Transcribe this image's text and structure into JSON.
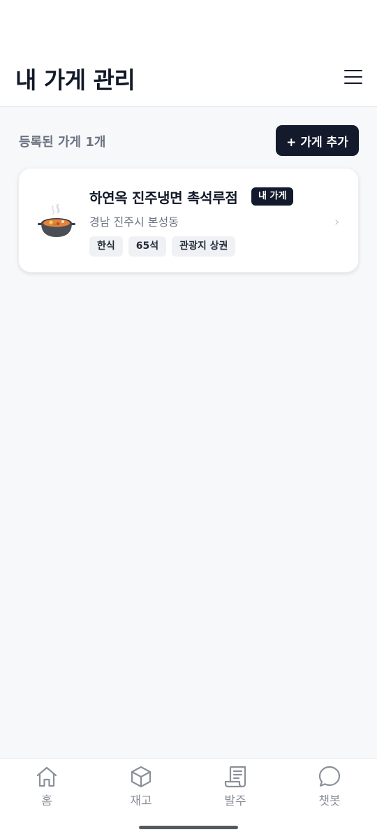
{
  "header": {
    "title": "내 가게 관리",
    "menu_icon": "hamburger-menu-icon"
  },
  "summary": {
    "count_label": "등록된 가게 1개",
    "add_button": "+ 가게 추가"
  },
  "stores": [
    {
      "icon": "pot-of-food-icon",
      "name": "하연옥 진주냉면 촉석루점",
      "badge": "내 가게",
      "address": "경남 진주시 본성동",
      "tags": [
        "한식",
        "65석",
        "관광지 상권"
      ]
    }
  ],
  "bottom_nav": {
    "items": [
      {
        "label": "홈",
        "icon": "home-icon"
      },
      {
        "label": "재고",
        "icon": "box-icon"
      },
      {
        "label": "발주",
        "icon": "receipt-icon"
      },
      {
        "label": "챗봇",
        "icon": "chat-bubble-icon"
      }
    ]
  },
  "colors": {
    "primary_dark": "#131a2b",
    "background": "#f7f8fa",
    "muted_text": "#6b7280",
    "tag_bg": "#f0f1f4"
  }
}
